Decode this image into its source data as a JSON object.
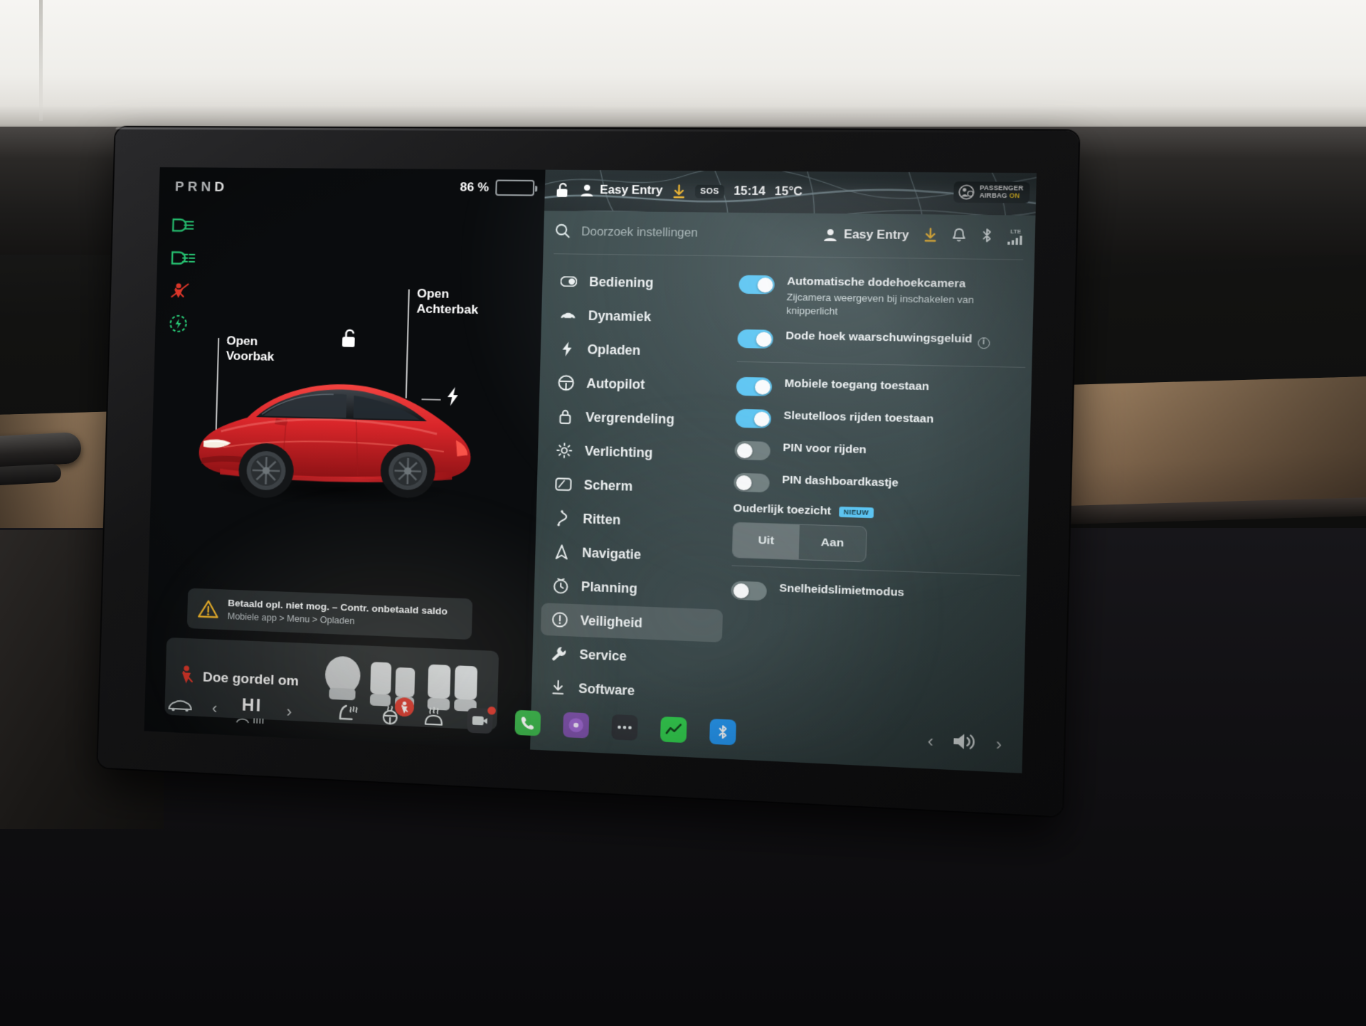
{
  "vehicle_panel": {
    "gear_indicator": {
      "letters": [
        "P",
        "R",
        "N",
        "D"
      ],
      "active": "D"
    },
    "battery": {
      "percent_label": "86 %",
      "level": 86
    },
    "telltales": [
      {
        "name": "low-beam-headlight-icon",
        "color": "#29d17a"
      },
      {
        "name": "fog-light-icon",
        "color": "#29d17a"
      },
      {
        "name": "seatbelt-warning-icon",
        "color": "#e8392b"
      },
      {
        "name": "charge-ready-icon",
        "color": "#29d17a"
      }
    ],
    "callouts": {
      "front_trunk": {
        "line1": "Open",
        "line2": "Voorbak"
      },
      "rear_trunk": {
        "line1": "Open",
        "line2": "Achterbak"
      }
    },
    "alert_card": {
      "line1": "Betaald opl. niet mog. – Contr. onbetaald saldo",
      "line2": "Mobiele app > Menu > Opladen"
    },
    "seatbelt_card": {
      "label": "Doe gordel om"
    }
  },
  "status_bar": {
    "lock_icon": "unlocked-padlock-icon",
    "profile_icon": "person-icon",
    "profile_name": "Easy Entry",
    "download_icon": "software-download-icon",
    "sos_label": "SOS",
    "time": "15:14",
    "temperature": "15°C",
    "passenger_airbag": {
      "line1": "PASSENGER",
      "line2": "AIRBAG",
      "state": "ON"
    }
  },
  "settings": {
    "search": {
      "placeholder": "Doorzoek instellingen",
      "icon": "search-icon"
    },
    "header_right": {
      "profile_icon": "person-icon",
      "profile_name": "Easy Entry",
      "download_icon": "software-download-icon",
      "bell_icon": "bell-icon",
      "bluetooth_icon": "bluetooth-icon",
      "signal_label": "LTE",
      "signal_icon": "cellular-bars-icon"
    },
    "nav_items": [
      {
        "label": "Bediening",
        "icon": "toggle-switch-icon",
        "active": false
      },
      {
        "label": "Dynamiek",
        "icon": "car-icon",
        "active": false
      },
      {
        "label": "Opladen",
        "icon": "lightning-bolt-icon",
        "active": false
      },
      {
        "label": "Autopilot",
        "icon": "steering-wheel-icon",
        "active": false
      },
      {
        "label": "Vergrendeling",
        "icon": "padlock-icon",
        "active": false
      },
      {
        "label": "Verlichting",
        "icon": "sun-brightness-icon",
        "active": false
      },
      {
        "label": "Scherm",
        "icon": "display-screen-icon",
        "active": false
      },
      {
        "label": "Ritten",
        "icon": "winding-road-icon",
        "active": false
      },
      {
        "label": "Navigatie",
        "icon": "navigation-arrow-icon",
        "active": false
      },
      {
        "label": "Planning",
        "icon": "clock-schedule-icon",
        "active": false
      },
      {
        "label": "Veiligheid",
        "icon": "safety-warning-icon",
        "active": true
      },
      {
        "label": "Service",
        "icon": "wrench-icon",
        "active": false
      },
      {
        "label": "Software",
        "icon": "download-arrow-icon",
        "active": false
      }
    ],
    "toggles_group_1": [
      {
        "label": "Automatische dodehoekcamera",
        "sublabel": "Zijcamera weergeven bij inschakelen van knipperlicht",
        "state": "on",
        "info": false
      },
      {
        "label": "Dode hoek waarschuwingsgeluid",
        "sublabel": "",
        "state": "on",
        "info": true,
        "info_glyph": "i"
      }
    ],
    "toggles_group_2": [
      {
        "label": "Mobiele toegang toestaan",
        "sublabel": "",
        "state": "on",
        "info": false
      },
      {
        "label": "Sleutelloos rijden toestaan",
        "sublabel": "",
        "state": "on",
        "info": false
      },
      {
        "label": "PIN voor rijden",
        "sublabel": "",
        "state": "off",
        "info": false
      },
      {
        "label": "PIN dashboardkastje",
        "sublabel": "",
        "state": "off",
        "info": false
      }
    ],
    "parental_section": {
      "title": "Ouderlijk toezicht",
      "badge": "NIEUW",
      "options": [
        {
          "label": "Uit",
          "selected": true
        },
        {
          "label": "Aan",
          "selected": false
        }
      ]
    },
    "toggles_group_3": [
      {
        "label": "Snelheidslimietmodus",
        "sublabel": "",
        "state": "off",
        "info": false
      }
    ]
  },
  "dock": {
    "car_icon": "car-front-icon",
    "prev_arrow": "chevron-left-icon",
    "next_arrow": "chevron-right-icon",
    "climate_label": "HI",
    "seat_heater_icon": "seat-heater-icon",
    "steering_heater_icon": "steering-wheel-heater-icon",
    "defrost_icon": "windshield-defrost-icon",
    "apps": [
      {
        "name": "camera-app",
        "label": "",
        "badge": "1",
        "color": "#2c2f33"
      },
      {
        "name": "phone-app",
        "label": "",
        "badge": "",
        "color": "#39b54a"
      },
      {
        "name": "media-app",
        "label": "",
        "badge": "",
        "color": "#7b4ea8"
      },
      {
        "name": "more-apps",
        "label": "",
        "badge": "",
        "color": "#2c2f33"
      },
      {
        "name": "energy-app",
        "label": "",
        "badge": "",
        "color": "#2ecc4a"
      },
      {
        "name": "bluetooth-app",
        "label": "",
        "badge": "",
        "color": "#2196f3"
      }
    ],
    "volume_icon": "speaker-volume-icon",
    "volume_prev": "chevron-left-icon",
    "volume_next": "chevron-right-icon"
  },
  "colors": {
    "accent_toggle_on": "#57c6f5",
    "warning_red": "#e8392b",
    "telltale_green": "#29d17a",
    "panel_bg": "#3e4e4f",
    "vehicle_bg": "#0a0c0e",
    "car_paint": "#d9262a"
  }
}
